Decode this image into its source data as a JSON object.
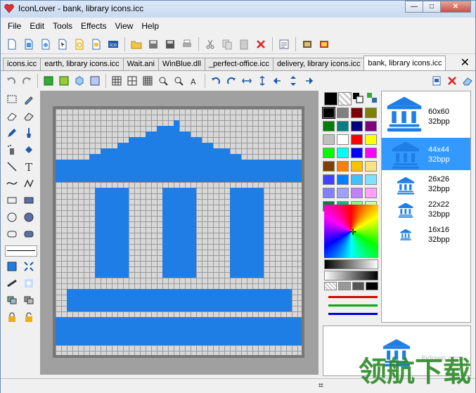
{
  "window": {
    "title": "IconLover - bank, library icons.icc"
  },
  "menubar": [
    {
      "label": "File"
    },
    {
      "label": "Edit"
    },
    {
      "label": "Tools"
    },
    {
      "label": "Effects"
    },
    {
      "label": "View"
    },
    {
      "label": "Help"
    }
  ],
  "tabs": [
    {
      "label": "icons.icc"
    },
    {
      "label": "earth, library icons.icc"
    },
    {
      "label": "Wait.ani"
    },
    {
      "label": "WinBlue.dll"
    },
    {
      "label": "_perfect-office.icc"
    },
    {
      "label": "delivery, library icons.icc"
    },
    {
      "label": "bank, library icons.icc"
    }
  ],
  "formats": [
    {
      "size": "60x60",
      "depth": "32bpp"
    },
    {
      "size": "44x44",
      "depth": "32bpp"
    },
    {
      "size": "26x26",
      "depth": "32bpp"
    },
    {
      "size": "22x22",
      "depth": "32bpp"
    },
    {
      "size": "16x16",
      "depth": "32bpp"
    }
  ],
  "palette_colors": [
    "#000000",
    "#808080",
    "#800000",
    "#808000",
    "#008000",
    "#008080",
    "#000080",
    "#800080",
    "#c0c0c0",
    "#ffffff",
    "#ff0000",
    "#ffff00",
    "#00ff00",
    "#00ffff",
    "#0000ff",
    "#ff00ff",
    "#804000",
    "#ff8000",
    "#ffc000",
    "#ffe080",
    "#4040ff",
    "#0080ff",
    "#40c0ff",
    "#80e0ff",
    "#8080ff",
    "#a0a0ff",
    "#c080ff",
    "#ffa0ff",
    "#008040",
    "#00c080",
    "#80ff80",
    "#c0ffc0"
  ],
  "icon_color": "#1e7ee6",
  "watermark": {
    "text": "领航下载",
    "url": "lhdown.com"
  }
}
